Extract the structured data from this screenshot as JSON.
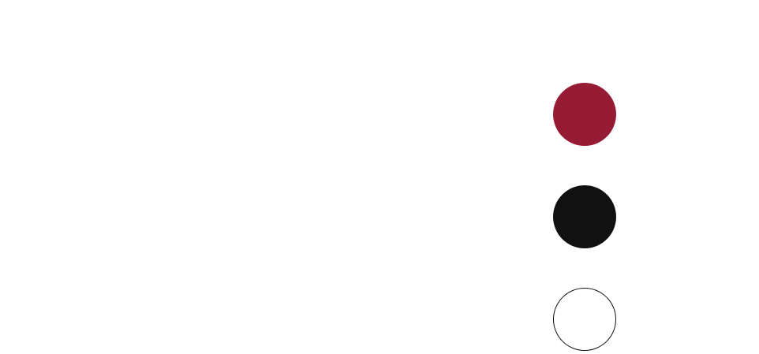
{
  "color_swatches": {
    "items": [
      {
        "name": "crimson",
        "color": "#961c35",
        "outlined": false
      },
      {
        "name": "black",
        "color": "#111111",
        "outlined": false
      },
      {
        "name": "white",
        "color": "#ffffff",
        "outlined": true
      }
    ],
    "outline_color": "#111111"
  }
}
